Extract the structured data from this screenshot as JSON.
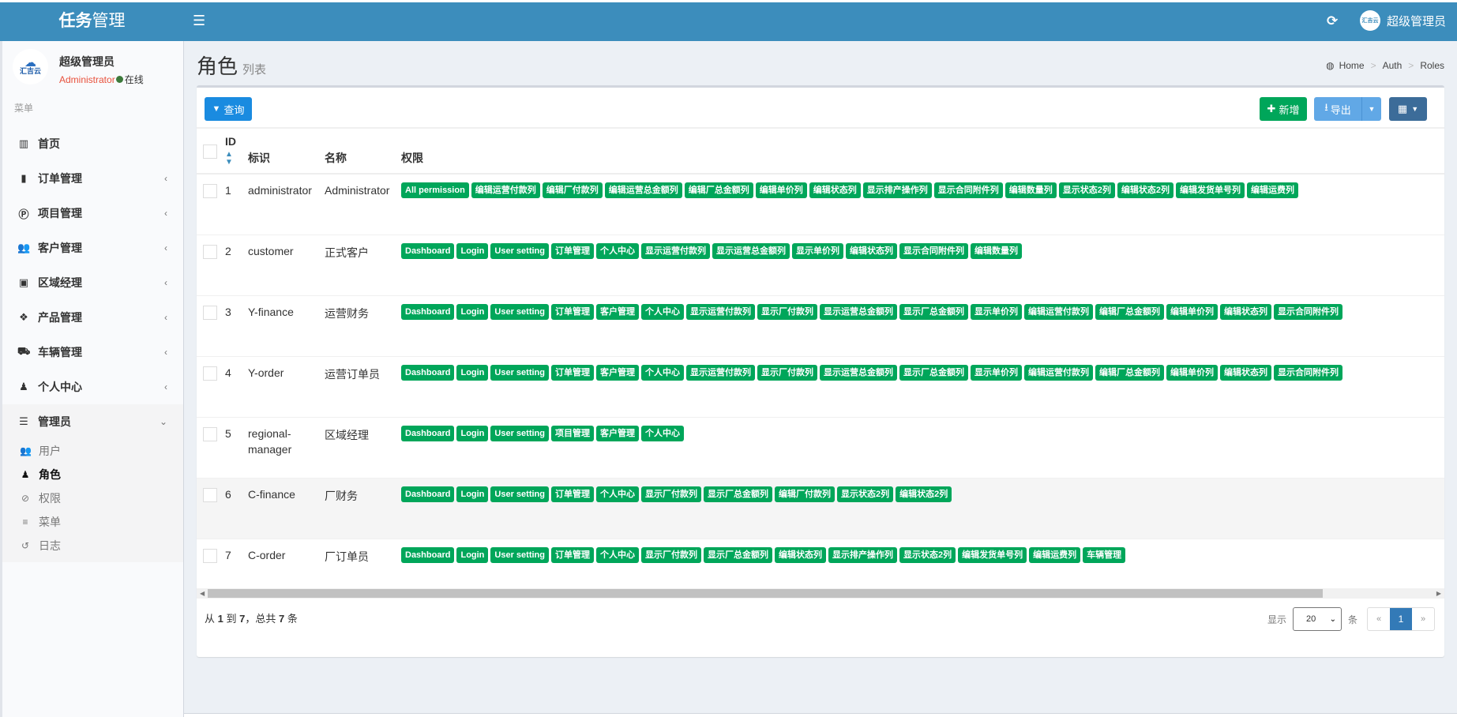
{
  "header": {
    "logo_bold": "任务",
    "logo_rest": "管理",
    "menu_toggle_icon": "☰",
    "refresh_icon": "⟳",
    "user_name": "超级管理员",
    "avatar_text": "汇吉云"
  },
  "sidebar": {
    "user": {
      "name": "超级管理员",
      "role": "Administrator",
      "status": "在线",
      "avatar_text": "汇吉云"
    },
    "menu_header": "菜单",
    "items": [
      {
        "label": "首页",
        "icon": "bar-chart-icon",
        "glyph": "▥",
        "has_children": false
      },
      {
        "label": "订单管理",
        "icon": "file-icon",
        "glyph": "▮",
        "has_children": true
      },
      {
        "label": "项目管理",
        "icon": "p-circle-icon",
        "glyph": "Ⓟ",
        "has_children": true
      },
      {
        "label": "客户管理",
        "icon": "users-icon",
        "glyph": "👥",
        "has_children": true
      },
      {
        "label": "区域经理",
        "icon": "briefcase-icon",
        "glyph": "▣",
        "has_children": true
      },
      {
        "label": "产品管理",
        "icon": "cubes-icon",
        "glyph": "❖",
        "has_children": true
      },
      {
        "label": "车辆管理",
        "icon": "truck-icon",
        "glyph": "⛟",
        "has_children": true
      },
      {
        "label": "个人中心",
        "icon": "user-icon",
        "glyph": "♟",
        "has_children": true
      }
    ],
    "admin": {
      "label": "管理员",
      "icon": "server-icon",
      "glyph": "☰",
      "children": [
        {
          "label": "用户",
          "icon": "users-icon",
          "glyph": "👥",
          "active": false
        },
        {
          "label": "角色",
          "icon": "user-icon",
          "glyph": "♟",
          "active": true
        },
        {
          "label": "权限",
          "icon": "ban-icon",
          "glyph": "⊘",
          "active": false
        },
        {
          "label": "菜单",
          "icon": "bars-icon",
          "glyph": "≡",
          "active": false
        },
        {
          "label": "日志",
          "icon": "history-icon",
          "glyph": "↺",
          "active": false
        }
      ]
    },
    "chevron_left": "‹",
    "chevron_down": "⌄"
  },
  "page": {
    "title": "角色",
    "subtitle": "列表",
    "breadcrumb": [
      "Home",
      "Auth",
      "Roles"
    ]
  },
  "toolbar": {
    "query_label": "查询",
    "add_label": "新增",
    "export_label": "导出",
    "columns_icon": "▦"
  },
  "table": {
    "columns": [
      "ID",
      "标识",
      "名称",
      "权限"
    ],
    "rows": [
      {
        "id": "1",
        "slug": "administrator",
        "name": "Administrator",
        "permissions": [
          "All permission",
          "编辑运营付款列",
          "编辑厂付款列",
          "编辑运营总金额列",
          "编辑厂总金额列",
          "编辑单价列",
          "编辑状态列",
          "显示排产操作列",
          "显示合同附件列",
          "编辑数量列",
          "显示状态2列",
          "编辑状态2列",
          "编辑发货单号列",
          "编辑运费列"
        ]
      },
      {
        "id": "2",
        "slug": "customer",
        "name": "正式客户",
        "permissions": [
          "Dashboard",
          "Login",
          "User setting",
          "订单管理",
          "个人中心",
          "显示运营付款列",
          "显示运营总金额列",
          "显示单价列",
          "编辑状态列",
          "显示合同附件列",
          "编辑数量列"
        ]
      },
      {
        "id": "3",
        "slug": "Y-finance",
        "name": "运营财务",
        "permissions": [
          "Dashboard",
          "Login",
          "User setting",
          "订单管理",
          "客户管理",
          "个人中心",
          "显示运营付款列",
          "显示厂付款列",
          "显示运营总金额列",
          "显示厂总金额列",
          "显示单价列",
          "编辑运营付款列",
          "编辑厂总金额列",
          "编辑单价列",
          "编辑状态列",
          "显示合同附件列"
        ]
      },
      {
        "id": "4",
        "slug": "Y-order",
        "name": "运营订单员",
        "permissions": [
          "Dashboard",
          "Login",
          "User setting",
          "订单管理",
          "客户管理",
          "个人中心",
          "显示运营付款列",
          "显示厂付款列",
          "显示运营总金额列",
          "显示厂总金额列",
          "显示单价列",
          "编辑运营付款列",
          "编辑厂总金额列",
          "编辑单价列",
          "编辑状态列",
          "显示合同附件列"
        ]
      },
      {
        "id": "5",
        "slug": "regional-manager",
        "name": "区域经理",
        "permissions": [
          "Dashboard",
          "Login",
          "User setting",
          "项目管理",
          "客户管理",
          "个人中心"
        ]
      },
      {
        "id": "6",
        "slug": "C-finance",
        "name": "厂财务",
        "permissions": [
          "Dashboard",
          "Login",
          "User setting",
          "订单管理",
          "个人中心",
          "显示厂付款列",
          "显示厂总金额列",
          "编辑厂付款列",
          "显示状态2列",
          "编辑状态2列"
        ]
      },
      {
        "id": "7",
        "slug": "C-order",
        "name": "厂订单员",
        "permissions": [
          "Dashboard",
          "Login",
          "User setting",
          "订单管理",
          "个人中心",
          "显示厂付款列",
          "显示厂总金额列",
          "编辑状态列",
          "显示排产操作列",
          "显示状态2列",
          "编辑发货单号列",
          "编辑运费列",
          "车辆管理"
        ]
      }
    ]
  },
  "footer": {
    "from_label": "从",
    "from": "1",
    "to_label": "到",
    "to": "7",
    "total_label": "，总共",
    "total": "7",
    "unit": "条",
    "show_label": "显示",
    "page_size": "20",
    "page_size_unit": "条",
    "prev": "«",
    "current_page": "1",
    "next": "»"
  }
}
